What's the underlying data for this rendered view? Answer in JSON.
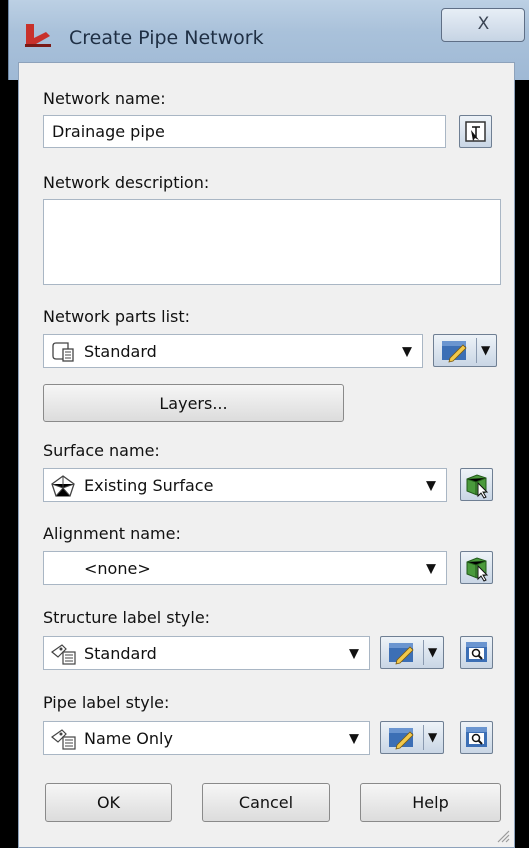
{
  "window": {
    "title": "Create Pipe Network",
    "close_glyph": "X"
  },
  "fields": {
    "network_name": {
      "label": "Network name:",
      "value": "Drainage pipe"
    },
    "network_description": {
      "label": "Network description:",
      "value": ""
    },
    "parts_list": {
      "label": "Network parts list:",
      "value": "Standard"
    },
    "layers_button": "Layers...",
    "surface": {
      "label": "Surface name:",
      "value": "Existing Surface"
    },
    "alignment": {
      "label": "Alignment name:",
      "value": "<none>"
    },
    "structure_label_style": {
      "label": "Structure label style:",
      "value": "Standard"
    },
    "pipe_label_style": {
      "label": "Pipe label style:",
      "value": "Name Only"
    }
  },
  "buttons": {
    "ok": "OK",
    "cancel": "Cancel",
    "help": "Help"
  },
  "icons": {
    "app": "autocad-civil-icon",
    "pick": "pick-from-drawing-icon",
    "parts_list": "parts-list-icon",
    "surface": "surface-icon",
    "label_style": "label-style-icon",
    "edit": "edit-style-icon",
    "select": "select-object-icon",
    "browse": "browse-style-icon"
  },
  "colors": {
    "titlebar": "#a9c1da",
    "dialog_bg": "#f0f0f0",
    "field_border": "#a9b6c4",
    "icon_blue": "#3c6fb5",
    "icon_green": "#4a9a3c",
    "app_red": "#c8312b"
  }
}
